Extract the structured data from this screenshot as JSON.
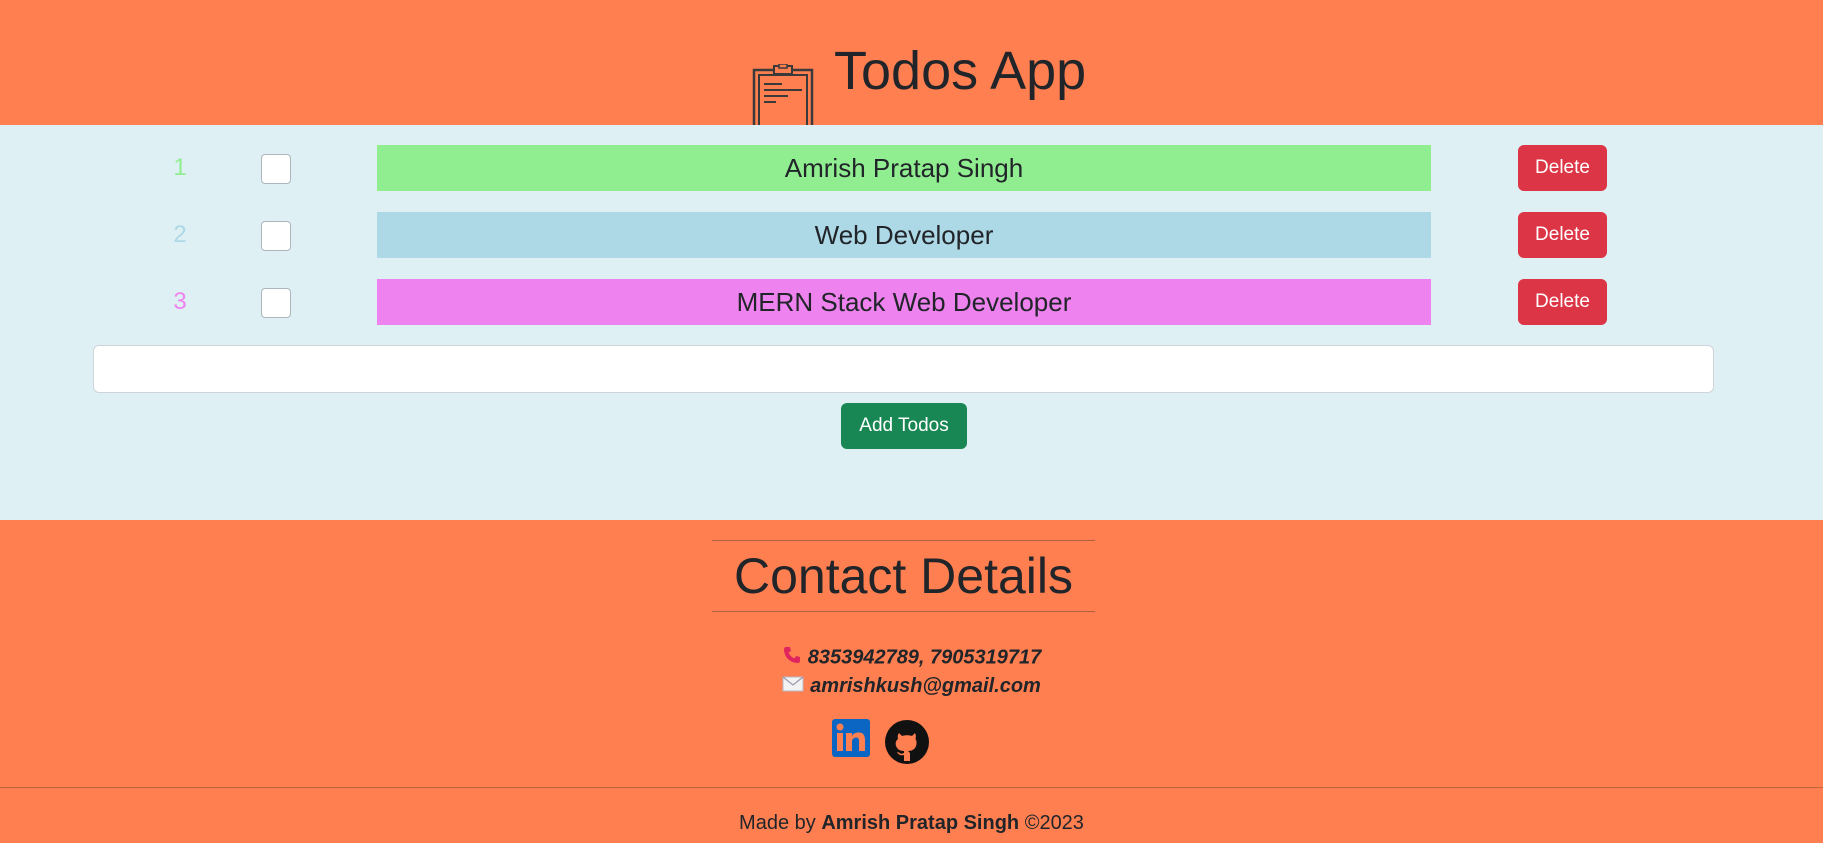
{
  "header": {
    "title": "Todos App"
  },
  "todos": [
    {
      "number": "1",
      "text": "Amrish Pratap Singh",
      "checked": false,
      "color": "#90ee90",
      "number_color": "#90ee90",
      "delete_label": "Delete"
    },
    {
      "number": "2",
      "text": "Web Developer",
      "checked": false,
      "color": "#add8e6",
      "number_color": "#add8e6",
      "delete_label": "Delete"
    },
    {
      "number": "3",
      "text": "MERN Stack Web Developer",
      "checked": false,
      "color": "#ee82ee",
      "number_color": "#ee82ee",
      "delete_label": "Delete"
    }
  ],
  "add_form": {
    "input_value": "",
    "add_label": "Add Todos"
  },
  "contact": {
    "title": "Contact Details",
    "phone": "8353942789, 7905319717",
    "email": "amrishkush@gmail.com",
    "icons": [
      "phone-icon",
      "email-icon",
      "linkedin-icon",
      "github-icon"
    ]
  },
  "footer": {
    "prefix": "Made by",
    "author": "Amrish Pratap Singh",
    "suffix": "©2023"
  },
  "colors": {
    "header_bg": "#ff7f50",
    "main_bg": "#dff0f5",
    "delete_btn": "#dc3545",
    "add_btn": "#198754",
    "linkedin": "#0a66c2"
  }
}
